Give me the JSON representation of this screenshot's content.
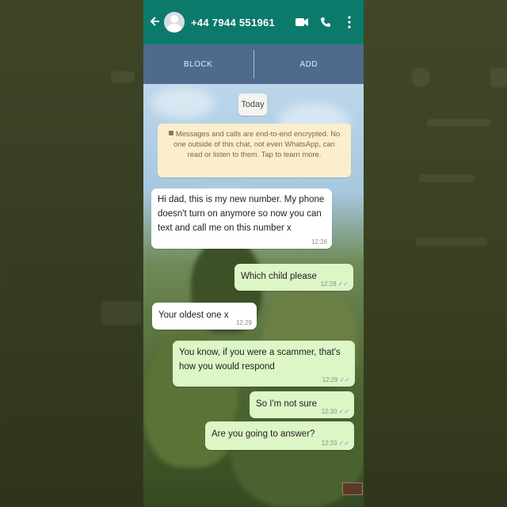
{
  "header": {
    "contact": "+44 7944 551961",
    "back_icon": "arrow-left-icon",
    "avatar_icon": "default-avatar-icon",
    "video_icon": "video-camera-icon",
    "call_icon": "phone-icon",
    "menu_icon": "more-vertical-icon",
    "color": "#0b7a6a"
  },
  "actions": {
    "block": "BLOCK",
    "add": "ADD"
  },
  "date_label": "Today",
  "encryption_notice": "Messages and calls are end-to-end encrypted. No one outside of this chat, not even WhatsApp, can read or listen to them. Tap to learn more.",
  "messages": [
    {
      "direction": "in",
      "text": "Hi dad, this is my new number. My phone doesn't turn on anymore so now you can text and call me on this number x",
      "time": "12:26"
    },
    {
      "direction": "out",
      "text": "Which child please",
      "time": "12:28"
    },
    {
      "direction": "in",
      "text": "Your oldest one x",
      "time": "12:29"
    },
    {
      "direction": "out",
      "text": "You know, if you were a scammer, that's how you would respond",
      "time": "12:29"
    },
    {
      "direction": "out",
      "text": "So I'm not sure",
      "time": "12:30"
    },
    {
      "direction": "out",
      "text": "Are you going to answer?",
      "time": "12:33"
    }
  ]
}
